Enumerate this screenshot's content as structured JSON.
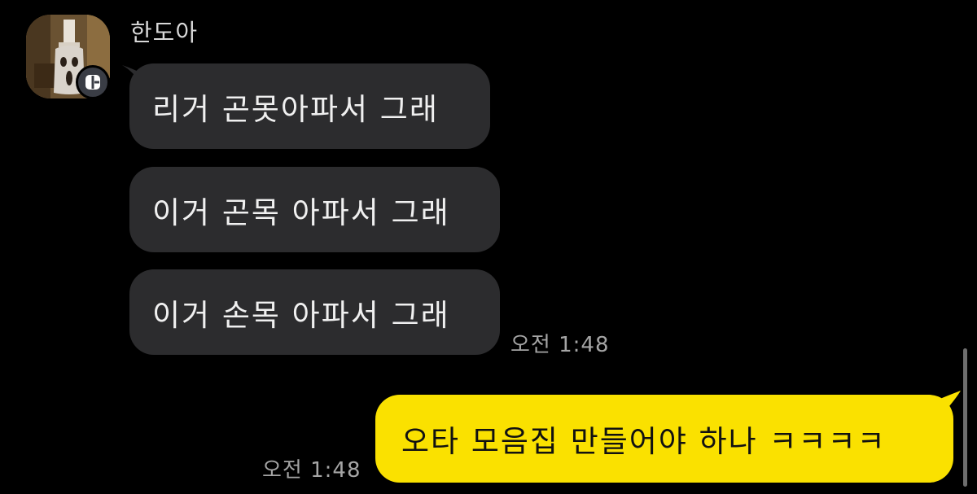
{
  "colors": {
    "background": "#000000",
    "incoming_bubble": "#2c2c2e",
    "outgoing_bubble": "#fae100",
    "timestamp": "#a5a5a5"
  },
  "sender": {
    "name": "한도아",
    "avatar_icon": "ghost-avatar-icon",
    "badge_icon": "kakao-chat-badge-icon"
  },
  "messages": {
    "in_1": "리거 곤못아파서 그래",
    "in_2": "이거 곤목 아파서 그래",
    "in_3": "이거 손목 아파서 그래",
    "in_time": "오전 1:48",
    "out_1": "오타 모음집 만들어야 하나 ㅋㅋㅋㅋ",
    "out_time": "오전 1:48"
  }
}
